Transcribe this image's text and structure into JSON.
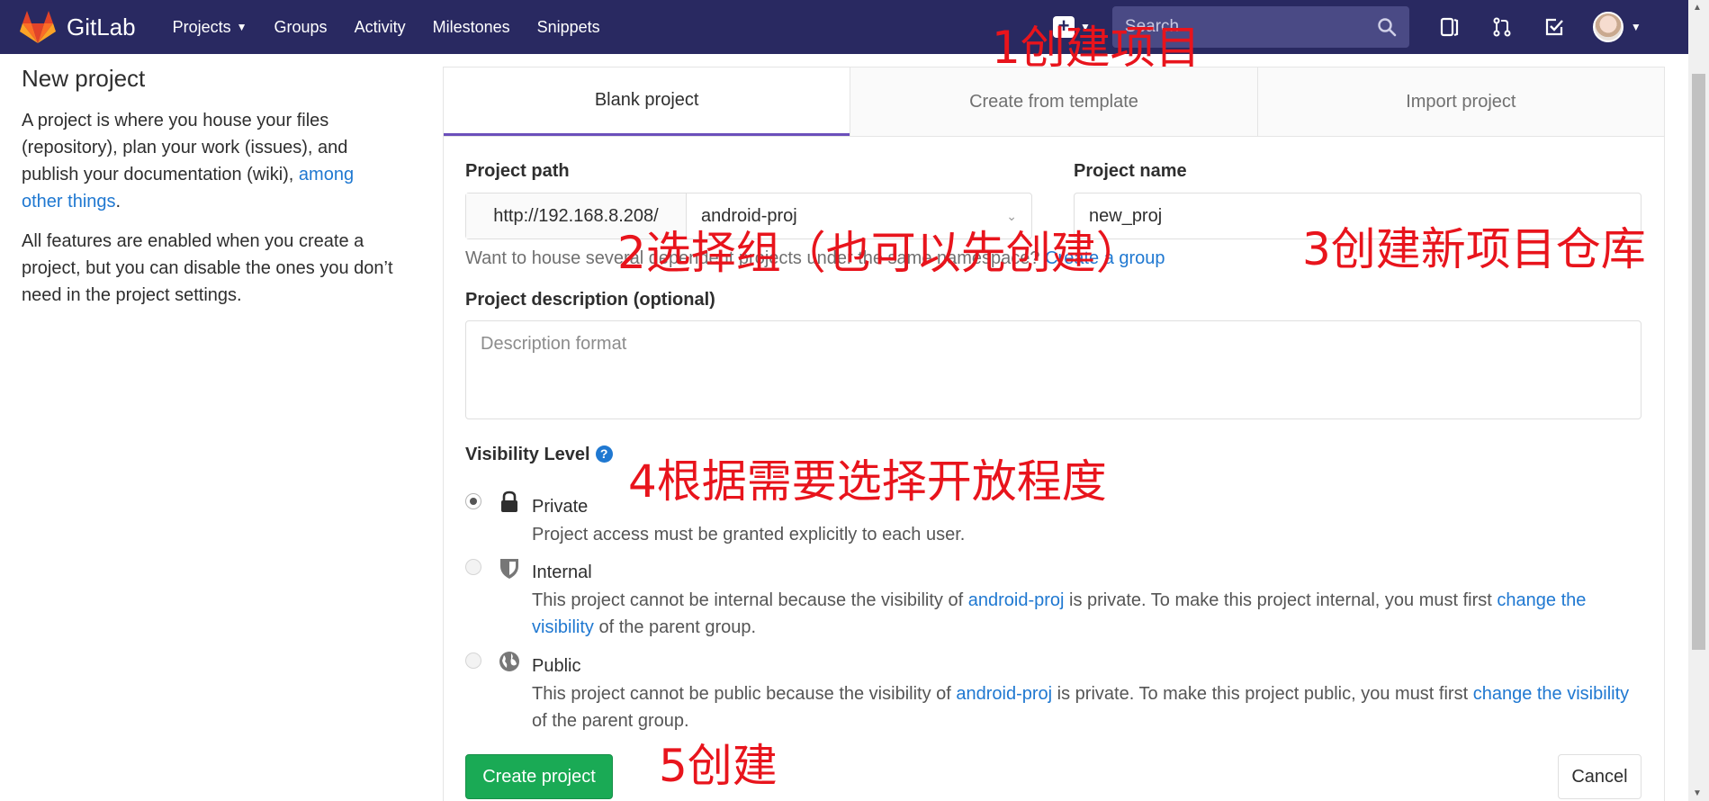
{
  "nav": {
    "logo_text": "GitLab",
    "links": [
      "Projects",
      "Groups",
      "Activity",
      "Milestones",
      "Snippets"
    ],
    "search_placeholder": "Search",
    "brand_color": "#292961"
  },
  "sidebar": {
    "title": "New project",
    "para1": "A project is where you house your files (repository), plan your work (issues), and publish your documentation (wiki), ",
    "para1_link": "among other things",
    "para1_end": ".",
    "para2": "All features are enabled when you create a project, but you can disable the ones you don’t need in the project settings."
  },
  "tabs": [
    "Blank project",
    "Create from template",
    "Import project"
  ],
  "form": {
    "path_label": "Project path",
    "path_prefix": "http://192.168.8.208/",
    "path_namespace": "android-proj",
    "name_label": "Project name",
    "name_value": "new_proj",
    "help_text": "Want to house several dependent projects under the same namespace? ",
    "help_link": "Create a group",
    "desc_label": "Project description (optional)",
    "desc_placeholder": "Description format",
    "visibility_label": "Visibility Level",
    "visibility": [
      {
        "title": "Private",
        "icon": "lock-icon",
        "checked": true,
        "desc": "Project access must be granted explicitly to each user."
      },
      {
        "title": "Internal",
        "icon": "shield-icon",
        "checked": false,
        "desc_a": "This project cannot be internal because the visibility of ",
        "desc_link1": "android-proj",
        "desc_b": " is private. To make this project internal, you must first ",
        "desc_link2": "change the visibility",
        "desc_c": " of the parent group."
      },
      {
        "title": "Public",
        "icon": "globe-icon",
        "checked": false,
        "desc_a": "This project cannot be public because the visibility of ",
        "desc_link1": "android-proj",
        "desc_b": " is private. To make this project public, you must first ",
        "desc_link2": "change the visibility",
        "desc_c": " of the parent group."
      }
    ],
    "create_button": "Create project",
    "cancel_button": "Cancel",
    "create_color": "#1aaa55"
  },
  "annotations": [
    "1创建项目",
    "2选择组（也可以先创建）",
    "3创建新项目仓库",
    "4根据需要选择开放程度",
    "5创建"
  ],
  "annotation_color": "#e8141c"
}
